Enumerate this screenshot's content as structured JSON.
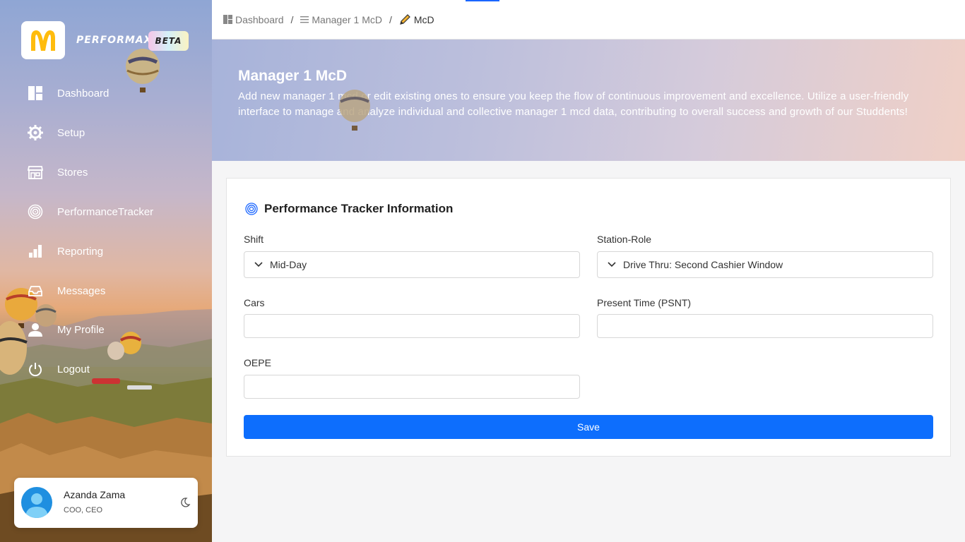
{
  "brand": {
    "name": "PERFORMAX",
    "badge": "BETA"
  },
  "sidebar": {
    "items": [
      {
        "label": "Dashboard",
        "icon": "dashboard-grid-icon"
      },
      {
        "label": "Setup",
        "icon": "gear-icon"
      },
      {
        "label": "Stores",
        "icon": "store-icon"
      },
      {
        "label": "PerformanceTracker",
        "icon": "target-icon"
      },
      {
        "label": "Reporting",
        "icon": "bar-chart-icon"
      },
      {
        "label": "Messages",
        "icon": "inbox-icon"
      },
      {
        "label": "My Profile",
        "icon": "user-icon"
      },
      {
        "label": "Logout",
        "icon": "power-icon"
      }
    ]
  },
  "user": {
    "name": "Azanda Zama",
    "role": "COO, CEO"
  },
  "breadcrumb": {
    "items": [
      "Dashboard",
      "Manager 1 McD",
      "McD"
    ]
  },
  "hero": {
    "title": "Manager 1 McD",
    "description": "Add new manager 1 mcd or edit existing ones to ensure you keep the flow of continuous improvement and excellence. Utilize a user-friendly interface to manage and analyze individual and collective manager 1 mcd data, contributing to overall success and growth of our Studdents!"
  },
  "form": {
    "title": "Performance Tracker Information",
    "shift": {
      "label": "Shift",
      "value": "Mid-Day"
    },
    "station_role": {
      "label": "Station-Role",
      "value": "Drive Thru: Second Cashier Window"
    },
    "cars": {
      "label": "Cars",
      "value": ""
    },
    "present_time": {
      "label": "Present Time (PSNT)",
      "value": ""
    },
    "oepe": {
      "label": "OEPE",
      "value": ""
    },
    "save_label": "Save"
  },
  "colors": {
    "primary": "#0d6efd",
    "logo_yellow": "#ffbc0d"
  }
}
